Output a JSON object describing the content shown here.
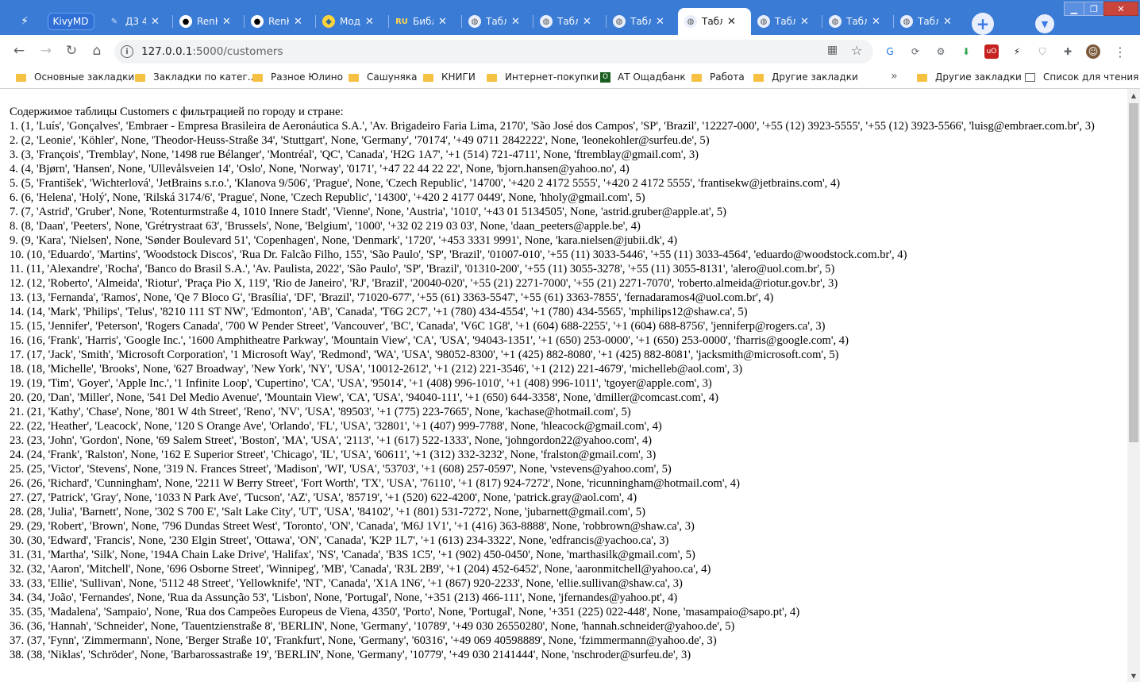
{
  "browser": {
    "tabs": [
      {
        "label": "Д3 4",
        "icon": "pencil-icon",
        "active": false
      },
      {
        "label": "RenK",
        "icon": "github-icon",
        "active": false
      },
      {
        "label": "RenK",
        "icon": "github-icon",
        "active": false
      },
      {
        "label": "Моду",
        "icon": "python-icon",
        "active": false
      },
      {
        "label": "Библ",
        "icon": "ru-icon",
        "active": false
      },
      {
        "label": "Табл",
        "icon": "globe-icon",
        "active": false
      },
      {
        "label": "Табл",
        "icon": "globe-icon",
        "active": false
      },
      {
        "label": "Табл",
        "icon": "globe-icon",
        "active": false
      },
      {
        "label": "Табл",
        "icon": "globe-icon",
        "active": true
      },
      {
        "label": "Табл",
        "icon": "globe-icon",
        "active": false
      },
      {
        "label": "Табл",
        "icon": "globe-icon",
        "active": false
      },
      {
        "label": "Табл",
        "icon": "globe-icon",
        "active": false
      }
    ],
    "pinned_tab_label": "KivyMD",
    "url_host": "127.0.0.1",
    "url_path": ":5000/customers",
    "bookmarks": [
      {
        "label": "Основные закладки"
      },
      {
        "label": "Закладки по катег..."
      },
      {
        "label": "Разное Юлино"
      },
      {
        "label": "Сашуняка"
      },
      {
        "label": "КНИГИ"
      },
      {
        "label": "Интернет-покупки"
      },
      {
        "label": "АТ Ощадбанк",
        "icon": "oschadbank-icon"
      },
      {
        "label": "Работа"
      },
      {
        "label": "Другие закладки"
      }
    ],
    "bookmarks_more": "»",
    "other_bookmarks": "Другие закладки",
    "reading_list": "Список для чтения",
    "colors": {
      "tabstrip": "#3a7bd5",
      "page_bg": "#ffffff",
      "folder": "#f6c042"
    }
  },
  "page": {
    "heading": "Содержимое таблицы Customers с фильтрацией по городу и стране:",
    "lines": [
      "1. (1, 'Luís', 'Gonçalves', 'Embraer - Empresa Brasileira de Aeronáutica S.A.', 'Av. Brigadeiro Faria Lima, 2170', 'São José dos Campos', 'SP', 'Brazil', '12227-000', '+55 (12) 3923-5555', '+55 (12) 3923-5566', 'luisg@embraer.com.br', 3)",
      "2. (2, 'Leonie', 'Köhler', None, 'Theodor-Heuss-Straße 34', 'Stuttgart', None, 'Germany', '70174', '+49 0711 2842222', None, 'leonekohler@surfeu.de', 5)",
      "3. (3, 'François', 'Tremblay', None, '1498 rue Bélanger', 'Montréal', 'QC', 'Canada', 'H2G 1A7', '+1 (514) 721-4711', None, 'ftremblay@gmail.com', 3)",
      "4. (4, 'Bjørn', 'Hansen', None, 'Ullevålsveien 14', 'Oslo', None, 'Norway', '0171', '+47 22 44 22 22', None, 'bjorn.hansen@yahoo.no', 4)",
      "5. (5, 'František', 'Wichterlová', 'JetBrains s.r.o.', 'Klanova 9/506', 'Prague', None, 'Czech Republic', '14700', '+420 2 4172 5555', '+420 2 4172 5555', 'frantisekw@jetbrains.com', 4)",
      "6. (6, 'Helena', 'Holý', None, 'Rilská 3174/6', 'Prague', None, 'Czech Republic', '14300', '+420 2 4177 0449', None, 'hholy@gmail.com', 5)",
      "7. (7, 'Astrid', 'Gruber', None, 'Rotenturmstraße 4, 1010 Innere Stadt', 'Vienne', None, 'Austria', '1010', '+43 01 5134505', None, 'astrid.gruber@apple.at', 5)",
      "8. (8, 'Daan', 'Peeters', None, 'Grétrystraat 63', 'Brussels', None, 'Belgium', '1000', '+32 02 219 03 03', None, 'daan_peeters@apple.be', 4)",
      "9. (9, 'Kara', 'Nielsen', None, 'Sønder Boulevard 51', 'Copenhagen', None, 'Denmark', '1720', '+453 3331 9991', None, 'kara.nielsen@jubii.dk', 4)",
      "10. (10, 'Eduardo', 'Martins', 'Woodstock Discos', 'Rua Dr. Falcão Filho, 155', 'São Paulo', 'SP', 'Brazil', '01007-010', '+55 (11) 3033-5446', '+55 (11) 3033-4564', 'eduardo@woodstock.com.br', 4)",
      "11. (11, 'Alexandre', 'Rocha', 'Banco do Brasil S.A.', 'Av. Paulista, 2022', 'São Paulo', 'SP', 'Brazil', '01310-200', '+55 (11) 3055-3278', '+55 (11) 3055-8131', 'alero@uol.com.br', 5)",
      "12. (12, 'Roberto', 'Almeida', 'Riotur', 'Praça Pio X, 119', 'Rio de Janeiro', 'RJ', 'Brazil', '20040-020', '+55 (21) 2271-7000', '+55 (21) 2271-7070', 'roberto.almeida@riotur.gov.br', 3)",
      "13. (13, 'Fernanda', 'Ramos', None, 'Qe 7 Bloco G', 'Brasília', 'DF', 'Brazil', '71020-677', '+55 (61) 3363-5547', '+55 (61) 3363-7855', 'fernadaramos4@uol.com.br', 4)",
      "14. (14, 'Mark', 'Philips', 'Telus', '8210 111 ST NW', 'Edmonton', 'AB', 'Canada', 'T6G 2C7', '+1 (780) 434-4554', '+1 (780) 434-5565', 'mphilips12@shaw.ca', 5)",
      "15. (15, 'Jennifer', 'Peterson', 'Rogers Canada', '700 W Pender Street', 'Vancouver', 'BC', 'Canada', 'V6C 1G8', '+1 (604) 688-2255', '+1 (604) 688-8756', 'jenniferp@rogers.ca', 3)",
      "16. (16, 'Frank', 'Harris', 'Google Inc.', '1600 Amphitheatre Parkway', 'Mountain View', 'CA', 'USA', '94043-1351', '+1 (650) 253-0000', '+1 (650) 253-0000', 'fharris@google.com', 4)",
      "17. (17, 'Jack', 'Smith', 'Microsoft Corporation', '1 Microsoft Way', 'Redmond', 'WA', 'USA', '98052-8300', '+1 (425) 882-8080', '+1 (425) 882-8081', 'jacksmith@microsoft.com', 5)",
      "18. (18, 'Michelle', 'Brooks', None, '627 Broadway', 'New York', 'NY', 'USA', '10012-2612', '+1 (212) 221-3546', '+1 (212) 221-4679', 'michelleb@aol.com', 3)",
      "19. (19, 'Tim', 'Goyer', 'Apple Inc.', '1 Infinite Loop', 'Cupertino', 'CA', 'USA', '95014', '+1 (408) 996-1010', '+1 (408) 996-1011', 'tgoyer@apple.com', 3)",
      "20. (20, 'Dan', 'Miller', None, '541 Del Medio Avenue', 'Mountain View', 'CA', 'USA', '94040-111', '+1 (650) 644-3358', None, 'dmiller@comcast.com', 4)",
      "21. (21, 'Kathy', 'Chase', None, '801 W 4th Street', 'Reno', 'NV', 'USA', '89503', '+1 (775) 223-7665', None, 'kachase@hotmail.com', 5)",
      "22. (22, 'Heather', 'Leacock', None, '120 S Orange Ave', 'Orlando', 'FL', 'USA', '32801', '+1 (407) 999-7788', None, 'hleacock@gmail.com', 4)",
      "23. (23, 'John', 'Gordon', None, '69 Salem Street', 'Boston', 'MA', 'USA', '2113', '+1 (617) 522-1333', None, 'johngordon22@yahoo.com', 4)",
      "24. (24, 'Frank', 'Ralston', None, '162 E Superior Street', 'Chicago', 'IL', 'USA', '60611', '+1 (312) 332-3232', None, 'fralston@gmail.com', 3)",
      "25. (25, 'Victor', 'Stevens', None, '319 N. Frances Street', 'Madison', 'WI', 'USA', '53703', '+1 (608) 257-0597', None, 'vstevens@yahoo.com', 5)",
      "26. (26, 'Richard', 'Cunningham', None, '2211 W Berry Street', 'Fort Worth', 'TX', 'USA', '76110', '+1 (817) 924-7272', None, 'ricunningham@hotmail.com', 4)",
      "27. (27, 'Patrick', 'Gray', None, '1033 N Park Ave', 'Tucson', 'AZ', 'USA', '85719', '+1 (520) 622-4200', None, 'patrick.gray@aol.com', 4)",
      "28. (28, 'Julia', 'Barnett', None, '302 S 700 E', 'Salt Lake City', 'UT', 'USA', '84102', '+1 (801) 531-7272', None, 'jubarnett@gmail.com', 5)",
      "29. (29, 'Robert', 'Brown', None, '796 Dundas Street West', 'Toronto', 'ON', 'Canada', 'M6J 1V1', '+1 (416) 363-8888', None, 'robbrown@shaw.ca', 3)",
      "30. (30, 'Edward', 'Francis', None, '230 Elgin Street', 'Ottawa', 'ON', 'Canada', 'K2P 1L7', '+1 (613) 234-3322', None, 'edfrancis@yachoo.ca', 3)",
      "31. (31, 'Martha', 'Silk', None, '194A Chain Lake Drive', 'Halifax', 'NS', 'Canada', 'B3S 1C5', '+1 (902) 450-0450', None, 'marthasilk@gmail.com', 5)",
      "32. (32, 'Aaron', 'Mitchell', None, '696 Osborne Street', 'Winnipeg', 'MB', 'Canada', 'R3L 2B9', '+1 (204) 452-6452', None, 'aaronmitchell@yahoo.ca', 4)",
      "33. (33, 'Ellie', 'Sullivan', None, '5112 48 Street', 'Yellowknife', 'NT', 'Canada', 'X1A 1N6', '+1 (867) 920-2233', None, 'ellie.sullivan@shaw.ca', 3)",
      "34. (34, 'João', 'Fernandes', None, 'Rua da Assunção 53', 'Lisbon', None, 'Portugal', None, '+351 (213) 466-111', None, 'jfernandes@yahoo.pt', 4)",
      "35. (35, 'Madalena', 'Sampaio', None, 'Rua dos Campeões Europeus de Viena, 4350', 'Porto', None, 'Portugal', None, '+351 (225) 022-448', None, 'masampaio@sapo.pt', 4)",
      "36. (36, 'Hannah', 'Schneider', None, 'Tauentzienstraße 8', 'BERLIN', None, 'Germany', '10789', '+49 030 26550280', None, 'hannah.schneider@yahoo.de', 5)",
      "37. (37, 'Fynn', 'Zimmermann', None, 'Berger Straße 10', 'Frankfurt', None, 'Germany', '60316', '+49 069 40598889', None, 'fzimmermann@yahoo.de', 3)",
      "38. (38, 'Niklas', 'Schröder', None, 'Barbarossastraße 19', 'BERLIN', None, 'Germany', '10779', '+49 030 2141444', None, 'nschroder@surfeu.de', 3)"
    ]
  }
}
